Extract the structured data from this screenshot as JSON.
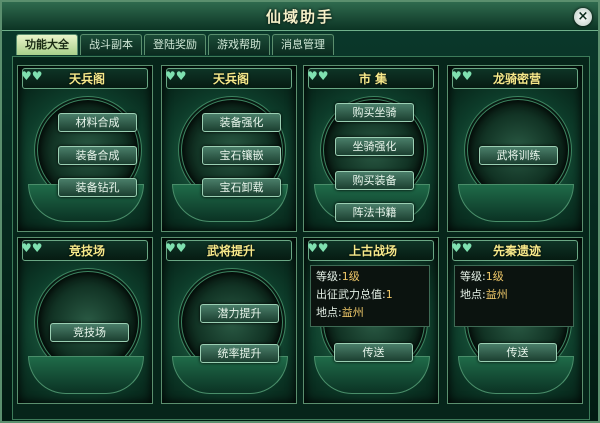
{
  "window": {
    "title": "仙域助手",
    "close_label": "×"
  },
  "tabs": [
    "功能大全",
    "战斗副本",
    "登陆奖励",
    "游戏帮助",
    "消息管理"
  ],
  "cards": [
    {
      "title": "天兵阁",
      "buttons": [
        "材料合成",
        "装备合成",
        "装备钻孔"
      ]
    },
    {
      "title": "天兵阁",
      "buttons": [
        "装备强化",
        "宝石镶嵌",
        "宝石卸载"
      ]
    },
    {
      "title": "市 集",
      "buttons": [
        "购买坐骑",
        "坐骑强化",
        "购买装备",
        "阵法书籍"
      ]
    },
    {
      "title": "龙骑密营",
      "buttons": [
        "武将训练"
      ]
    },
    {
      "title": "竞技场",
      "buttons": [
        "竞技场"
      ]
    },
    {
      "title": "武将提升",
      "buttons": [
        "潜力提升",
        "统率提升"
      ]
    },
    {
      "title": "上古战场",
      "info": [
        {
          "label": "等级:",
          "value": "1级"
        },
        {
          "label": "出征武力总值:",
          "value": "1"
        },
        {
          "label": "地点:",
          "value": "益州"
        }
      ],
      "buttons": [
        "传送"
      ]
    },
    {
      "title": "先秦遗迹",
      "info": [
        {
          "label": "等级:",
          "value": "1级"
        },
        {
          "label": "地点:",
          "value": "益州"
        }
      ],
      "buttons": [
        "传送"
      ]
    }
  ]
}
